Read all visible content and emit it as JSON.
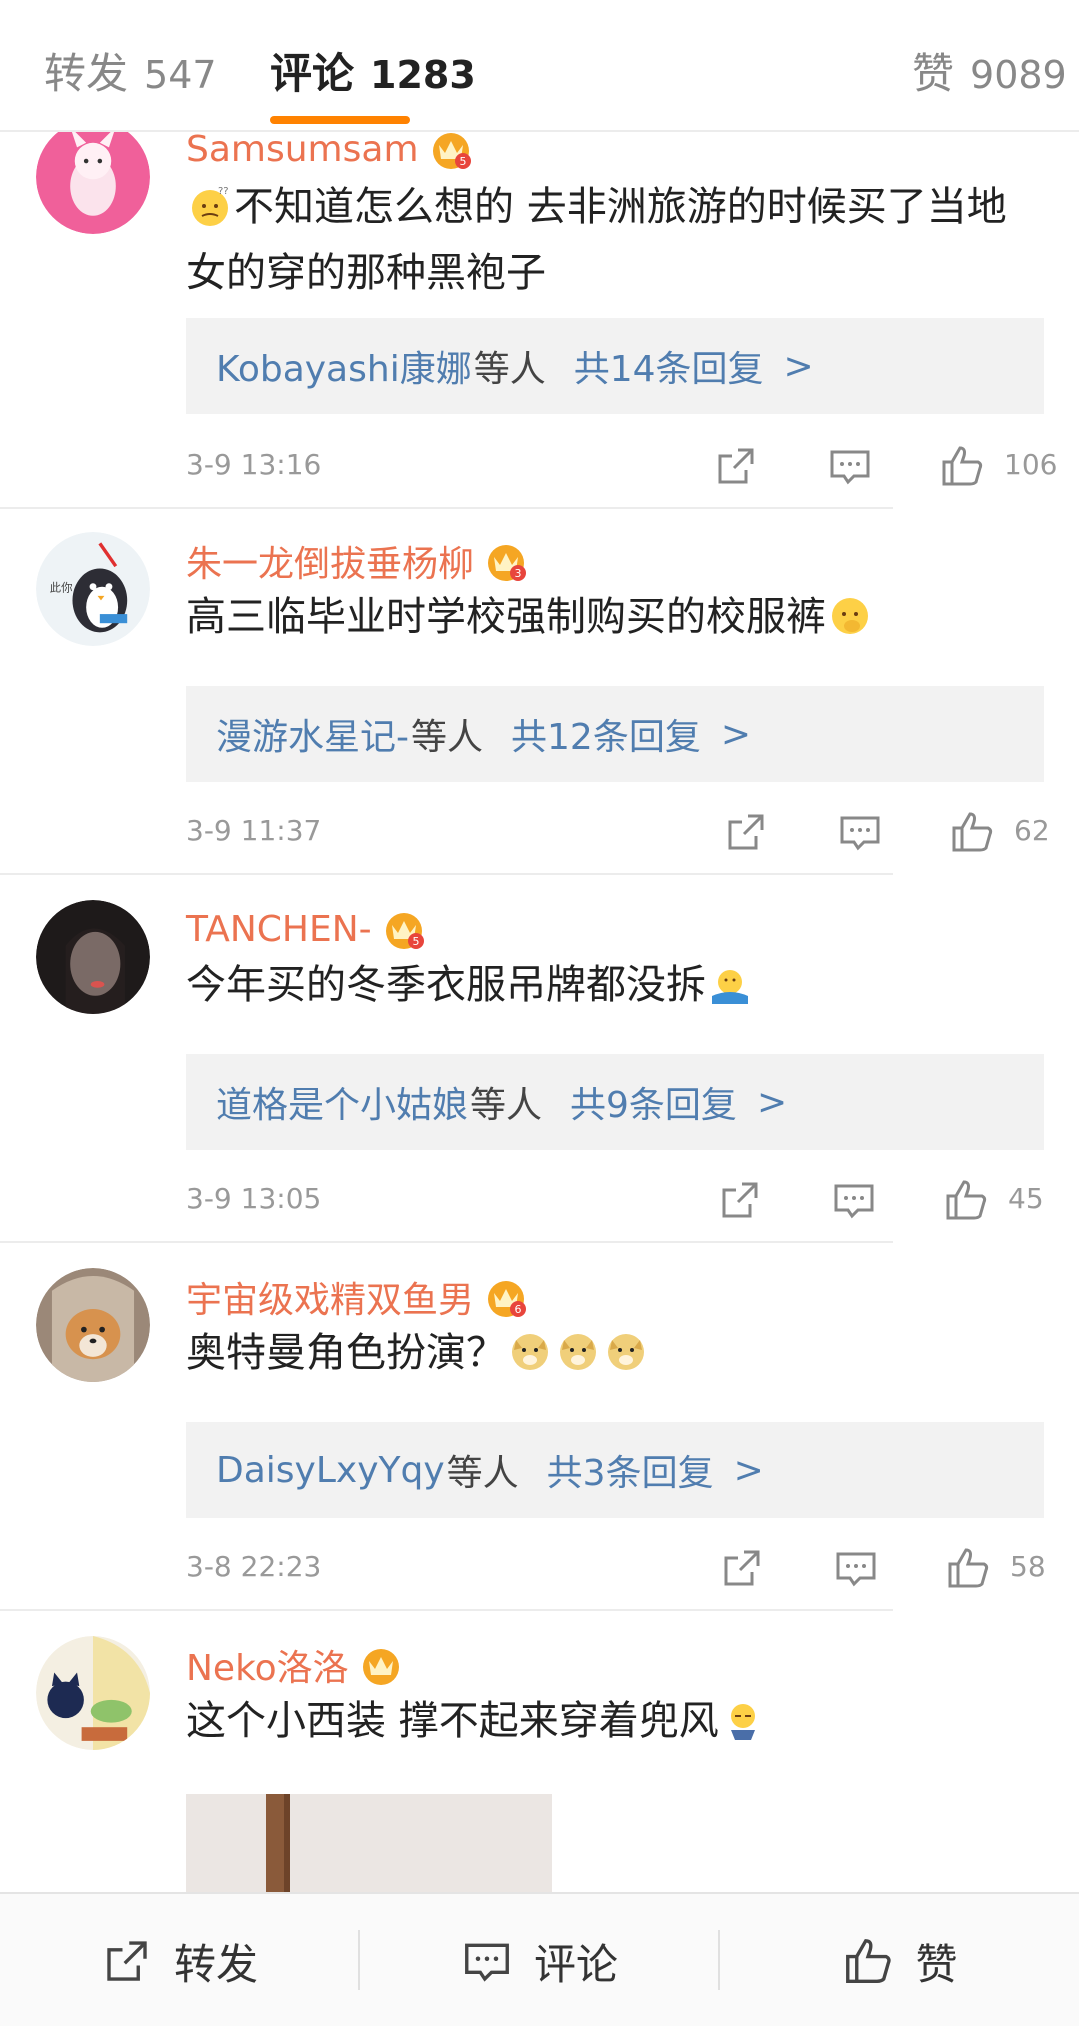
{
  "tabs": {
    "repost": {
      "label": "转发",
      "count": "547"
    },
    "comments": {
      "label": "评论",
      "count": "1283"
    },
    "likes": {
      "label": "赞",
      "count": "9089"
    }
  },
  "colors": {
    "accent": "#ff8200",
    "username": "#eb7350",
    "link": "#507daf"
  },
  "comments": [
    {
      "username": "Samsumsam",
      "badge_level": "5",
      "text": "不知道怎么想的 去非洲旅游的时候买了当地女的穿的那种黑袍子",
      "leading_emoji": "thinking-face-emoji",
      "reply_names": "Kobayashi康娜",
      "reply_mid": "等人",
      "reply_total": "共14条回复",
      "time": "3-9 13:16",
      "likes": "106"
    },
    {
      "username": "朱一龙倒拔垂杨柳",
      "badge_level": "3",
      "text": "高三临毕业时学校强制购买的校服裤",
      "trailing_emoji": "pondering-face-emoji",
      "reply_names": "漫游水星记-",
      "reply_mid": "等人",
      "reply_total": "共12条回复",
      "time": "3-9 11:37",
      "likes": "62"
    },
    {
      "username": "TANCHEN-",
      "badge_level": "5",
      "text": "今年买的冬季衣服吊牌都没拆",
      "trailing_emoji": "shrug-emoji",
      "reply_names": "道格是个小姑娘",
      "reply_mid": "等人",
      "reply_total": "共9条回复",
      "time": "3-9 13:05",
      "likes": "45"
    },
    {
      "username": "宇宙级戏精双鱼男",
      "badge_level": "6",
      "text": "奥特曼角色扮演？",
      "trailing_emoji": "doge-emoji",
      "reply_names": "DaisyLxyYqy",
      "reply_mid": "等人",
      "reply_total": "共3条回复",
      "time": "3-8 22:23",
      "likes": "58"
    },
    {
      "username": "Neko洛洛",
      "badge_level": "",
      "text": "这个小西装 撑不起来穿着兜风",
      "trailing_emoji": "sweat-emoji"
    }
  ],
  "arrow": ">",
  "bottom_bar": {
    "repost": "转发",
    "comment": "评论",
    "like": "赞"
  }
}
